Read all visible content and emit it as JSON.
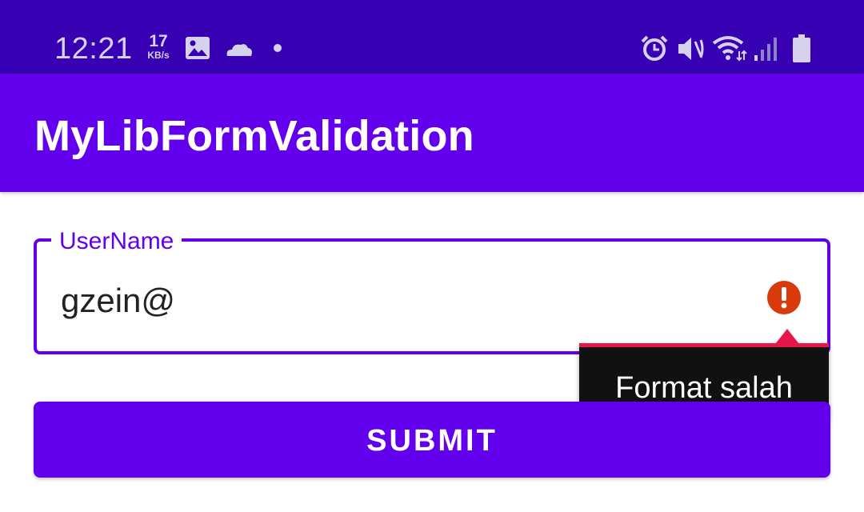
{
  "status_bar": {
    "time": "12:21",
    "net_speed_value": "17",
    "net_speed_unit": "KB/s",
    "left_icons": [
      "image-icon",
      "cloud-icon",
      "notification-dot-icon"
    ],
    "right_icons": [
      "alarm-icon",
      "vibrate-mute-icon",
      "wifi-icon",
      "signal-icon",
      "battery-icon"
    ]
  },
  "app_bar": {
    "title": "MyLibFormValidation"
  },
  "form": {
    "username": {
      "label": "UserName",
      "value": "gzein@",
      "error_icon": "error-alert-icon",
      "error_message": "Format salah"
    },
    "submit_label": "SUBMIT"
  },
  "colors": {
    "status_bar": "#3700b3",
    "primary": "#6200ee",
    "error": "#e8174a",
    "error_icon": "#d93a0c",
    "tooltip_bg": "#111111"
  }
}
